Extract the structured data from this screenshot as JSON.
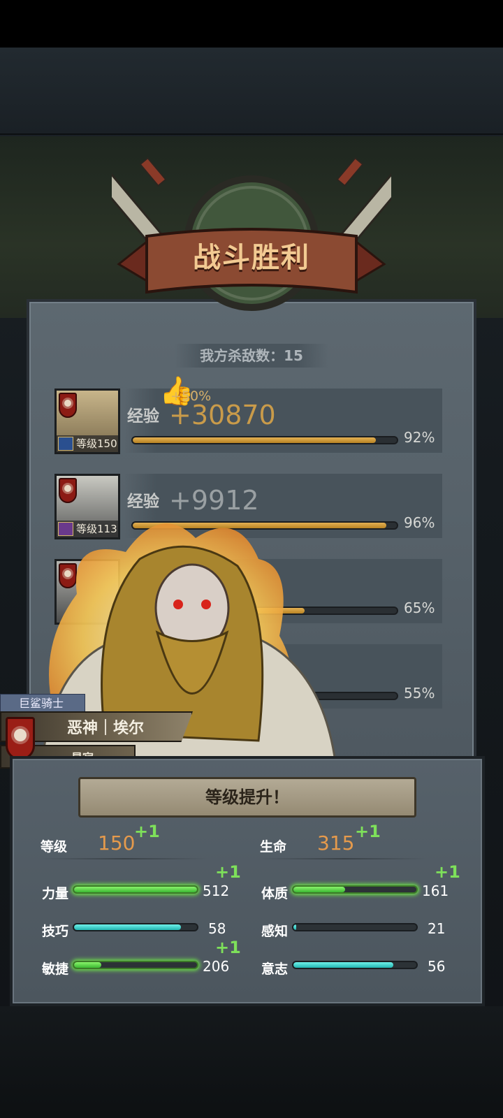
{
  "banner": {
    "title": "战斗胜利"
  },
  "kills": {
    "text": "我方杀敌数：15"
  },
  "rows": [
    {
      "level_text": "等级150",
      "exp_label": "经验",
      "exp_value": "+30870",
      "bonus": "+50%",
      "progress": 0.92,
      "pct": "92%"
    },
    {
      "level_text": "等级113",
      "exp_label": "经验",
      "exp_value": "+9912",
      "progress": 0.96,
      "pct": "96%"
    },
    {
      "progress": 0.65,
      "pct": "65%"
    },
    {
      "progress": 0.55,
      "pct": "55%"
    }
  ],
  "hero": {
    "class_tag": "巨鲨骑士",
    "name": "恶神｜埃尔",
    "title": "星寂"
  },
  "levelup": {
    "title": "等级提升！",
    "level": {
      "label": "等级",
      "value": "150",
      "plus": "+1"
    },
    "hp": {
      "label": "生命",
      "value": "315",
      "plus": "+1"
    },
    "stats": [
      {
        "label": "力量",
        "value": "512",
        "progress": 1.0,
        "plus": "+1",
        "color": "green"
      },
      {
        "label": "体质",
        "value": "161",
        "progress": 0.42,
        "plus": "+1",
        "color": "green"
      },
      {
        "label": "技巧",
        "value": "58",
        "progress": 0.87,
        "color": "teal"
      },
      {
        "label": "感知",
        "value": "21",
        "progress": 0.02,
        "color": "teal"
      },
      {
        "label": "敏捷",
        "value": "206",
        "progress": 0.22,
        "plus": "+1",
        "color": "green"
      },
      {
        "label": "意志",
        "value": "56",
        "progress": 0.81,
        "color": "teal"
      }
    ]
  },
  "colors": {
    "exp_bar": "#d9a13f",
    "green_bar": "#5fd64a",
    "teal_bar": "#3fd3cf",
    "shield_red": "#8c1b14"
  }
}
